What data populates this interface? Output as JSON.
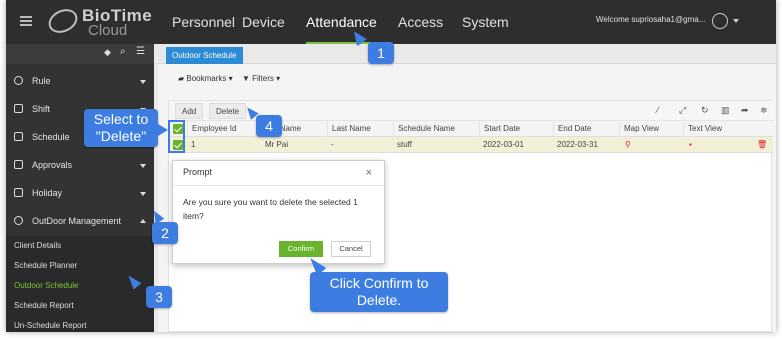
{
  "app": {
    "logo_line1": "BioTime",
    "logo_line2": "Cloud",
    "nav": [
      "Personnel",
      "Device",
      "Attendance",
      "Access",
      "System"
    ],
    "active_nav": "Attendance",
    "welcome": "Welcome supriosaha1@gma..."
  },
  "sidebar": {
    "items": [
      {
        "label": "Rule",
        "icon": "rule-icon"
      },
      {
        "label": "Shift",
        "icon": "shift-icon"
      },
      {
        "label": "Schedule",
        "icon": "calendar-icon"
      },
      {
        "label": "Approvals",
        "icon": "approvals-icon"
      },
      {
        "label": "Holiday",
        "icon": "holiday-icon"
      },
      {
        "label": "OutDoor Management",
        "icon": "bike-icon"
      }
    ],
    "subitems": [
      "Client Details",
      "Schedule Planner",
      "Outdoor Schedule",
      "Schedule Report",
      "Un-Schedule Report"
    ],
    "active_subitem": "Outdoor Schedule"
  },
  "page": {
    "tab": "Outdoor Schedule",
    "bookmarks": "Bookmarks",
    "filters": "Filters",
    "add": "Add",
    "delete": "Delete"
  },
  "table": {
    "columns": [
      "Employee Id",
      "First Name",
      "Last Name",
      "Schedule Name",
      "Start Date",
      "End Date",
      "Map View",
      "Text View"
    ],
    "row": {
      "employee_id": "1",
      "first_name": "Mr Pai",
      "last_name": "-",
      "schedule_name": "stuff",
      "start_date": "2022-03-01",
      "end_date": "2022-03-31"
    }
  },
  "modal": {
    "title": "Prompt",
    "close": "×",
    "message": "Are you sure you want to delete the selected 1 item?",
    "confirm": "Confirm",
    "cancel": "Cancel"
  },
  "callouts": {
    "step1": "1",
    "step2": "2",
    "step3": "3",
    "step4": "4",
    "select_note": "Select to \"Delete\"",
    "confirm_note": "Click Confirm to Delete."
  },
  "colors": {
    "accent": "#7ec13b",
    "callout": "#3d7de1",
    "tab": "#2d8bd6"
  }
}
